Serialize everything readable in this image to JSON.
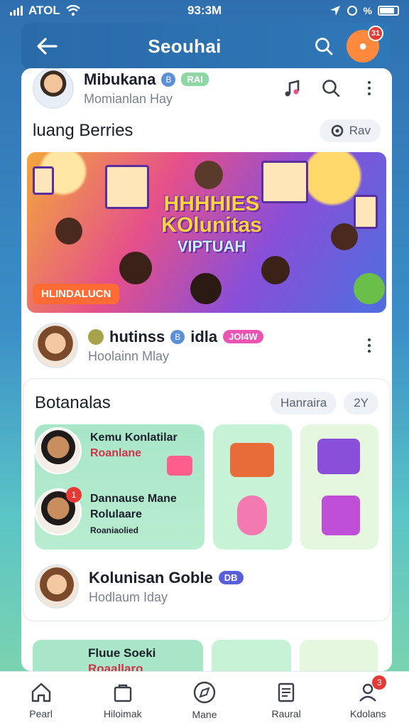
{
  "status_bar": {
    "carrier": "ATOL",
    "time": "93:3M"
  },
  "header": {
    "title": "Seouhai",
    "notification_count": "31"
  },
  "profile_1": {
    "name": "Mibukana",
    "verified_glyph": "B",
    "tag": "RAI",
    "subtitle": "Momianlan Hay"
  },
  "section_1": {
    "title": "luang Berries",
    "chip": "Rav"
  },
  "banner": {
    "title_line1": "HHHHIES",
    "title_line2": "KOlunitas",
    "title_line3": "VIPTUAH",
    "tag": "HLINDALUCN"
  },
  "profile_2": {
    "name": "hutinss",
    "verified_glyph": "B",
    "name_suffix": "idla",
    "tag": "JOI4W",
    "subtitle": "Hoolainn Mlay"
  },
  "section_2": {
    "title": "Botanalas",
    "chip_1": "Hanraira",
    "chip_2": "2Y"
  },
  "tile_big": {
    "line1": "Kemu Konlatilar",
    "line2": "Roanlane",
    "line3": "Dannause Mane",
    "line4": "Rolulaare",
    "line5": "Roaniaolied",
    "badge": "1"
  },
  "profile_3": {
    "name": "Kolunisan Goble",
    "tag": "DB",
    "subtitle": "Hodlaum Iday"
  },
  "peek": {
    "line1": "Fluue Soeki",
    "line2": "Roaallaro"
  },
  "nav": [
    {
      "label": "Pearl",
      "icon": "home-icon"
    },
    {
      "label": "Hiloimak",
      "icon": "bag-icon"
    },
    {
      "label": "Mane",
      "icon": "compass-icon"
    },
    {
      "label": "Raural",
      "icon": "document-icon"
    },
    {
      "label": "Kdolans",
      "icon": "profile-icon",
      "badge": "3"
    }
  ],
  "colors": {
    "accent": "#2f78b8",
    "badge": "#e53935",
    "pink": "#ea55b3",
    "green": "#8ed6a3"
  }
}
